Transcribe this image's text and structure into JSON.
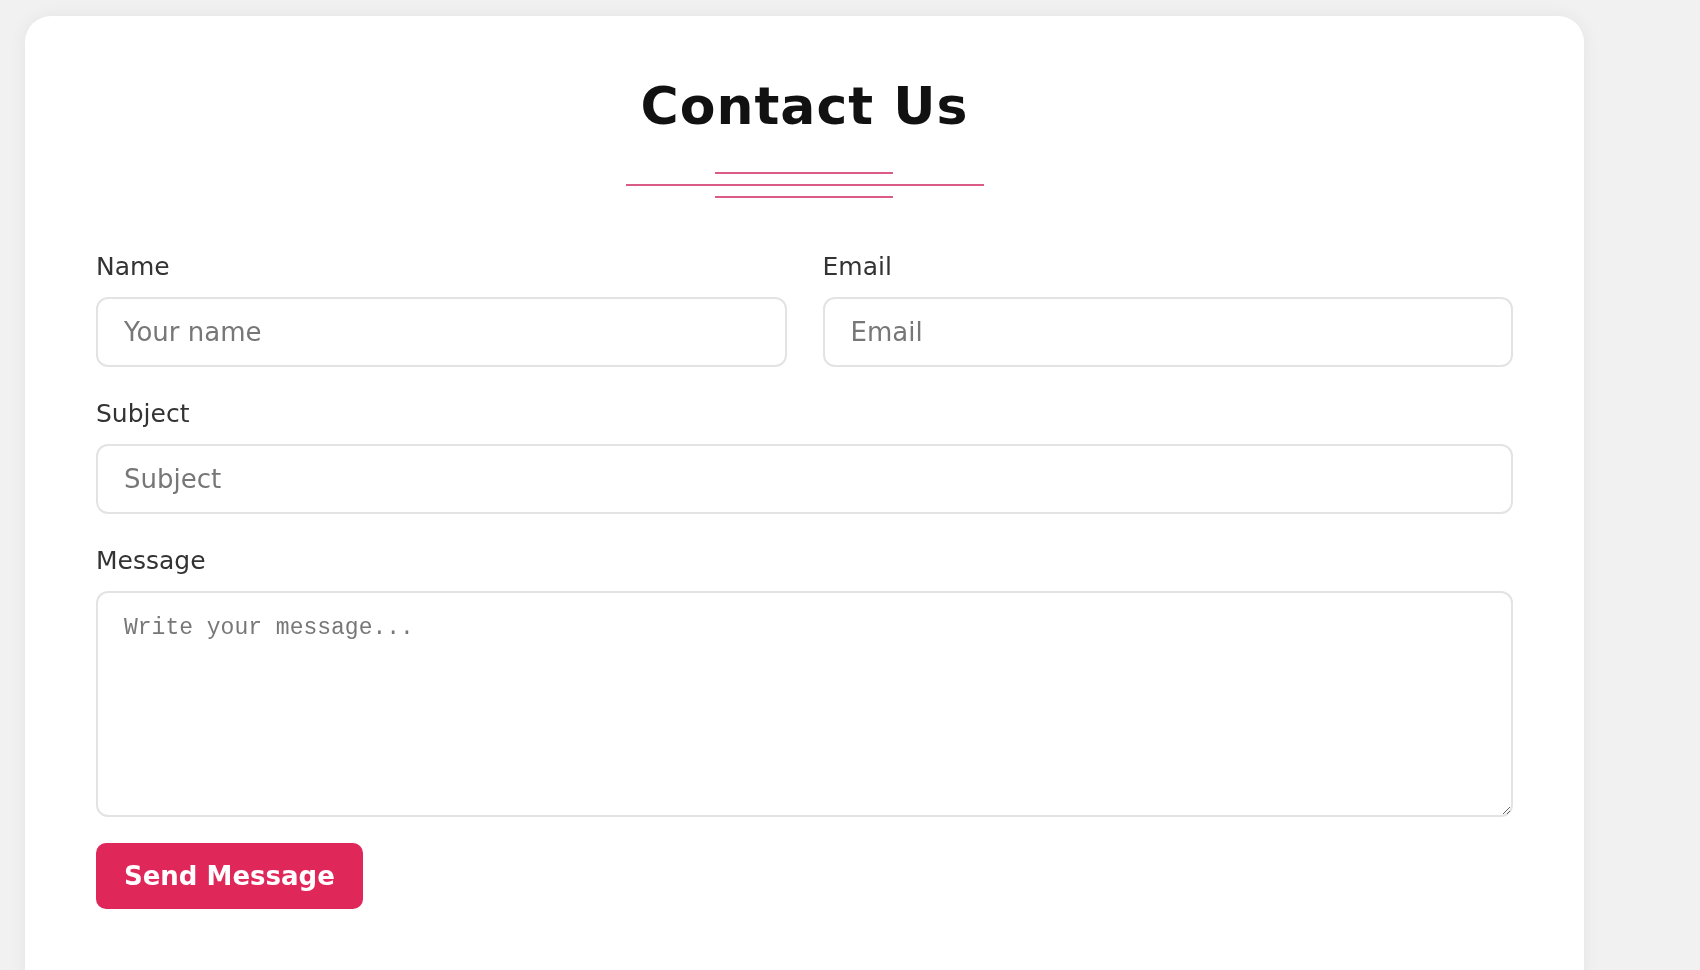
{
  "title": "Contact Us",
  "fields": [
    {
      "label": "Name",
      "placeholder": "Your name",
      "kind": "input"
    },
    {
      "label": "Email",
      "placeholder": "Email",
      "kind": "input"
    },
    {
      "label": "Subject",
      "placeholder": "Subject",
      "kind": "input"
    },
    {
      "label": "Message",
      "placeholder": "Write your message...",
      "kind": "textarea"
    }
  ],
  "submit": {
    "label": "Send Message"
  }
}
